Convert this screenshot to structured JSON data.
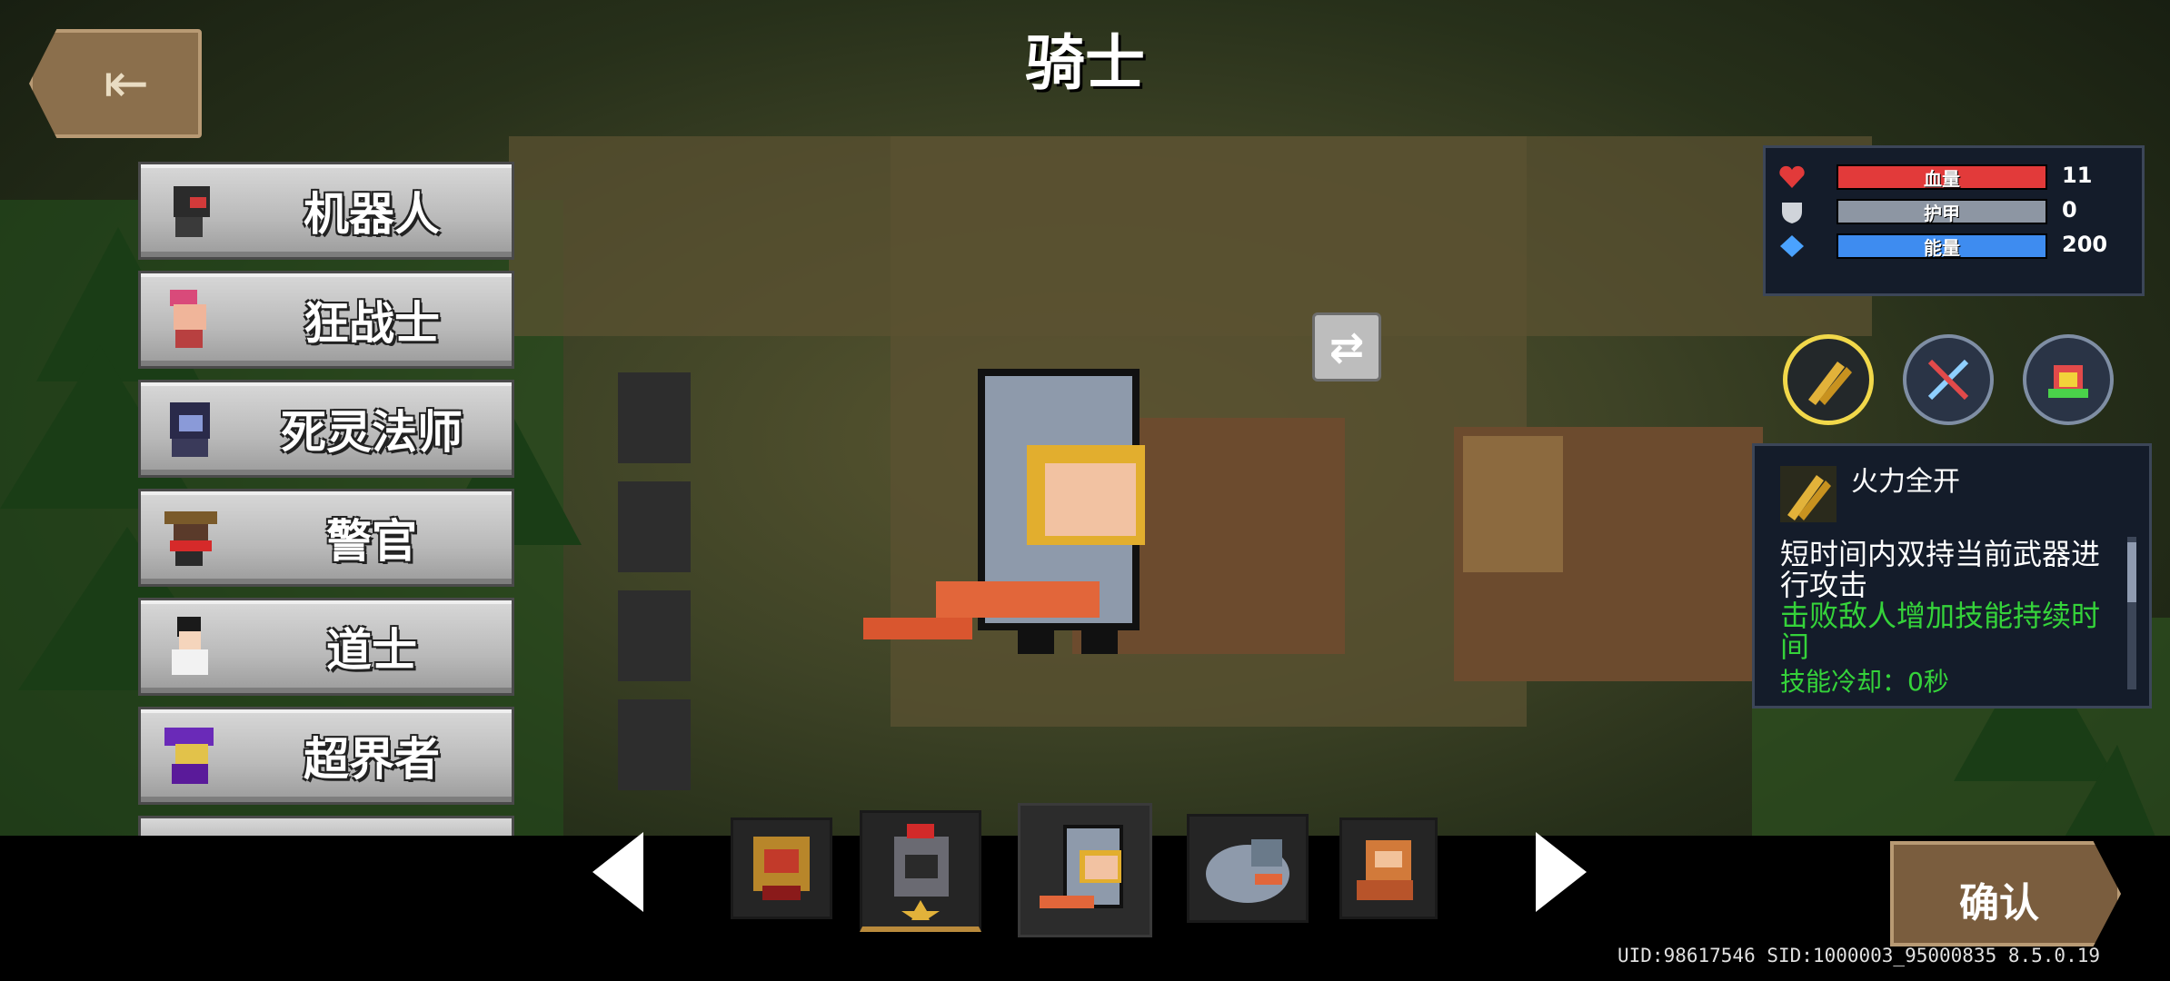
{
  "header": {
    "title": "骑士",
    "back_icon": "exit-door-icon"
  },
  "character_list": {
    "items": [
      {
        "label": "机器人",
        "icon": "robot-avatar-icon"
      },
      {
        "label": "狂战士",
        "icon": "berserker-avatar-icon"
      },
      {
        "label": "死灵法师",
        "icon": "necromancer-avatar-icon"
      },
      {
        "label": "警官",
        "icon": "officer-avatar-icon"
      },
      {
        "label": "道士",
        "icon": "taoist-avatar-icon"
      },
      {
        "label": "超界者",
        "icon": "transcender-avatar-icon"
      }
    ]
  },
  "stats": {
    "hp": {
      "label": "血量",
      "value": "11",
      "color": "#e23a3a"
    },
    "armor": {
      "label": "护甲",
      "value": "0",
      "color": "#8d96a3"
    },
    "energy": {
      "label": "能量",
      "value": "200",
      "color": "#3e8cf0"
    }
  },
  "skills": {
    "selected": {
      "name": "火力全开",
      "icon": "dual-wield-icon"
    },
    "description": "短时间内双持当前武器进行攻击",
    "effect": "击败敌人增加技能持续时间",
    "cooldown": "技能冷却：0秒"
  },
  "skins": [
    "lion-knight-skin",
    "dark-knight-skin",
    "knight-default-skin",
    "pigeon-knight-skin",
    "cat-knight-skin"
  ],
  "confirm_label": "确认",
  "footer": {
    "uid": "UID:98617546 SID:1000003_95000835 8.5.0.19"
  }
}
